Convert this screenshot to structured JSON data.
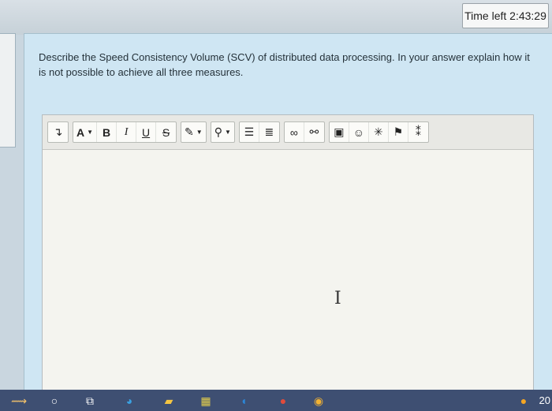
{
  "header": {
    "timer_label": "Time left 2:43:29"
  },
  "question": {
    "text": "Describe the Speed Consistency Volume (SCV) of distributed data processing. In your answer explain how it is not possible to achieve all three measures."
  },
  "toolbar": {
    "groups": [
      {
        "buttons": [
          {
            "name": "paragraph-style",
            "label": "↴"
          }
        ]
      },
      {
        "buttons": [
          {
            "name": "font-size",
            "label": "A"
          },
          {
            "name": "bold",
            "label": "B"
          },
          {
            "name": "italic",
            "label": "I"
          },
          {
            "name": "underline",
            "label": "U"
          },
          {
            "name": "strikethrough",
            "label": "S"
          }
        ]
      },
      {
        "buttons": [
          {
            "name": "text-color",
            "label": "✎"
          }
        ]
      },
      {
        "buttons": [
          {
            "name": "highlight-color",
            "label": "⚲"
          }
        ]
      },
      {
        "buttons": [
          {
            "name": "bullet-list",
            "label": "☰"
          },
          {
            "name": "numbered-list",
            "label": "≣"
          }
        ]
      },
      {
        "buttons": [
          {
            "name": "link",
            "label": "∞"
          },
          {
            "name": "unlink",
            "label": "⚯"
          }
        ]
      },
      {
        "buttons": [
          {
            "name": "image",
            "label": "▣"
          },
          {
            "name": "emoji",
            "label": "☺"
          },
          {
            "name": "special-char",
            "label": "✳"
          },
          {
            "name": "flag",
            "label": "⚑"
          },
          {
            "name": "more",
            "label": "⁑"
          }
        ]
      }
    ]
  },
  "taskbar": {
    "clock": "20"
  },
  "colors": {
    "card_bg": "#cfe6f3",
    "taskbar_bg": "#3e4f72",
    "editor_bg": "#f4f4ef"
  }
}
